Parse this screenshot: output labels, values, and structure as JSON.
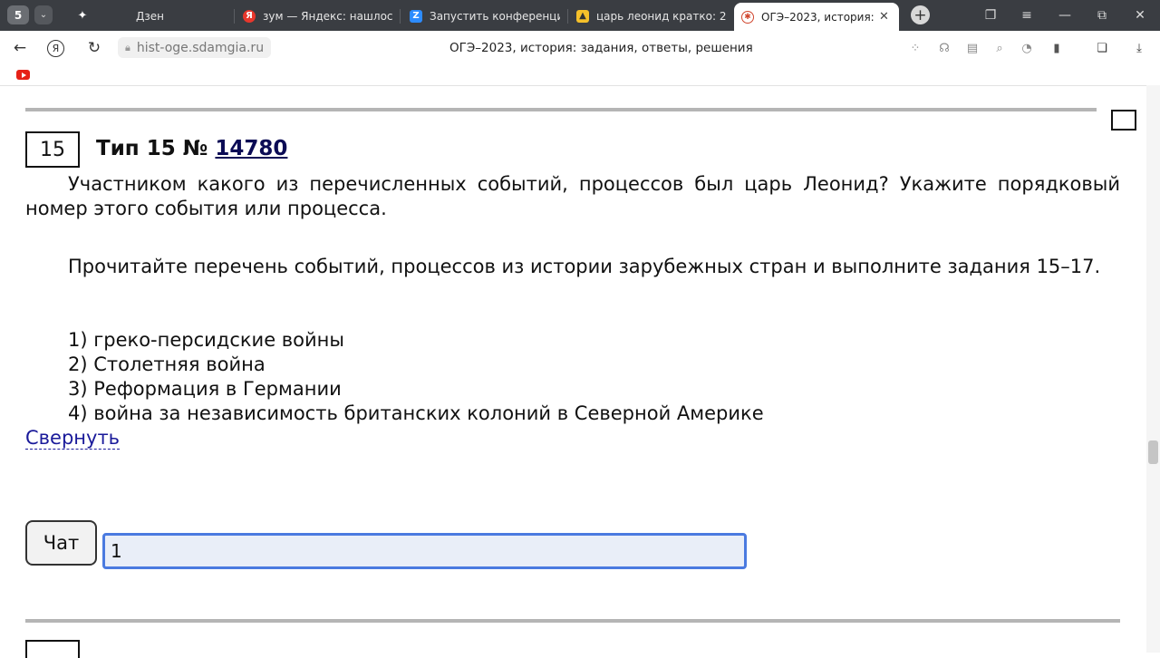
{
  "browser": {
    "profile_badge": "5",
    "tabs": [
      {
        "label": "Дзен",
        "favicon": "zen-icon",
        "color": "#111111"
      },
      {
        "label": "зум — Яндекс: нашлось 5",
        "favicon": "yandex-icon",
        "color": "#e8372c"
      },
      {
        "label": "Запустить конференцию",
        "favicon": "zoom-icon",
        "color": "#2d8cff"
      },
      {
        "label": "царь леонид кратко: 2 ты",
        "favicon": "images-icon",
        "color": "#f5c02a"
      },
      {
        "label": "ОГЭ–2023, история: за",
        "favicon": "sdamgia-icon",
        "color": "#d0452d"
      }
    ],
    "url": "hist-oge.sdamgia.ru",
    "page_title": "ОГЭ–2023, история: задания, ответы, решения"
  },
  "task": {
    "number": "15",
    "heading_prefix": "Тип 15 № ",
    "id_link": "14780",
    "question": "Участником какого из перечисленных событий, процессов был царь Леонид? Укажите порядковый номер этого события или процесса.",
    "instruction": "Прочитайте перечень событий, процессов из истории зарубежных стран и выполните задания 15–17.",
    "options": [
      "1) греко-персидские войны",
      "2) Столетняя война",
      "3) Реформация в Германии",
      "4) война за независимость британских колоний в Северной Америке"
    ],
    "collapse_label": "Свернуть",
    "chat_label": "Чат",
    "answer_value": "1"
  },
  "colors": {
    "link": "#0b0b55",
    "answer_border": "#4a7ae0",
    "answer_bg": "#e9eef8"
  }
}
